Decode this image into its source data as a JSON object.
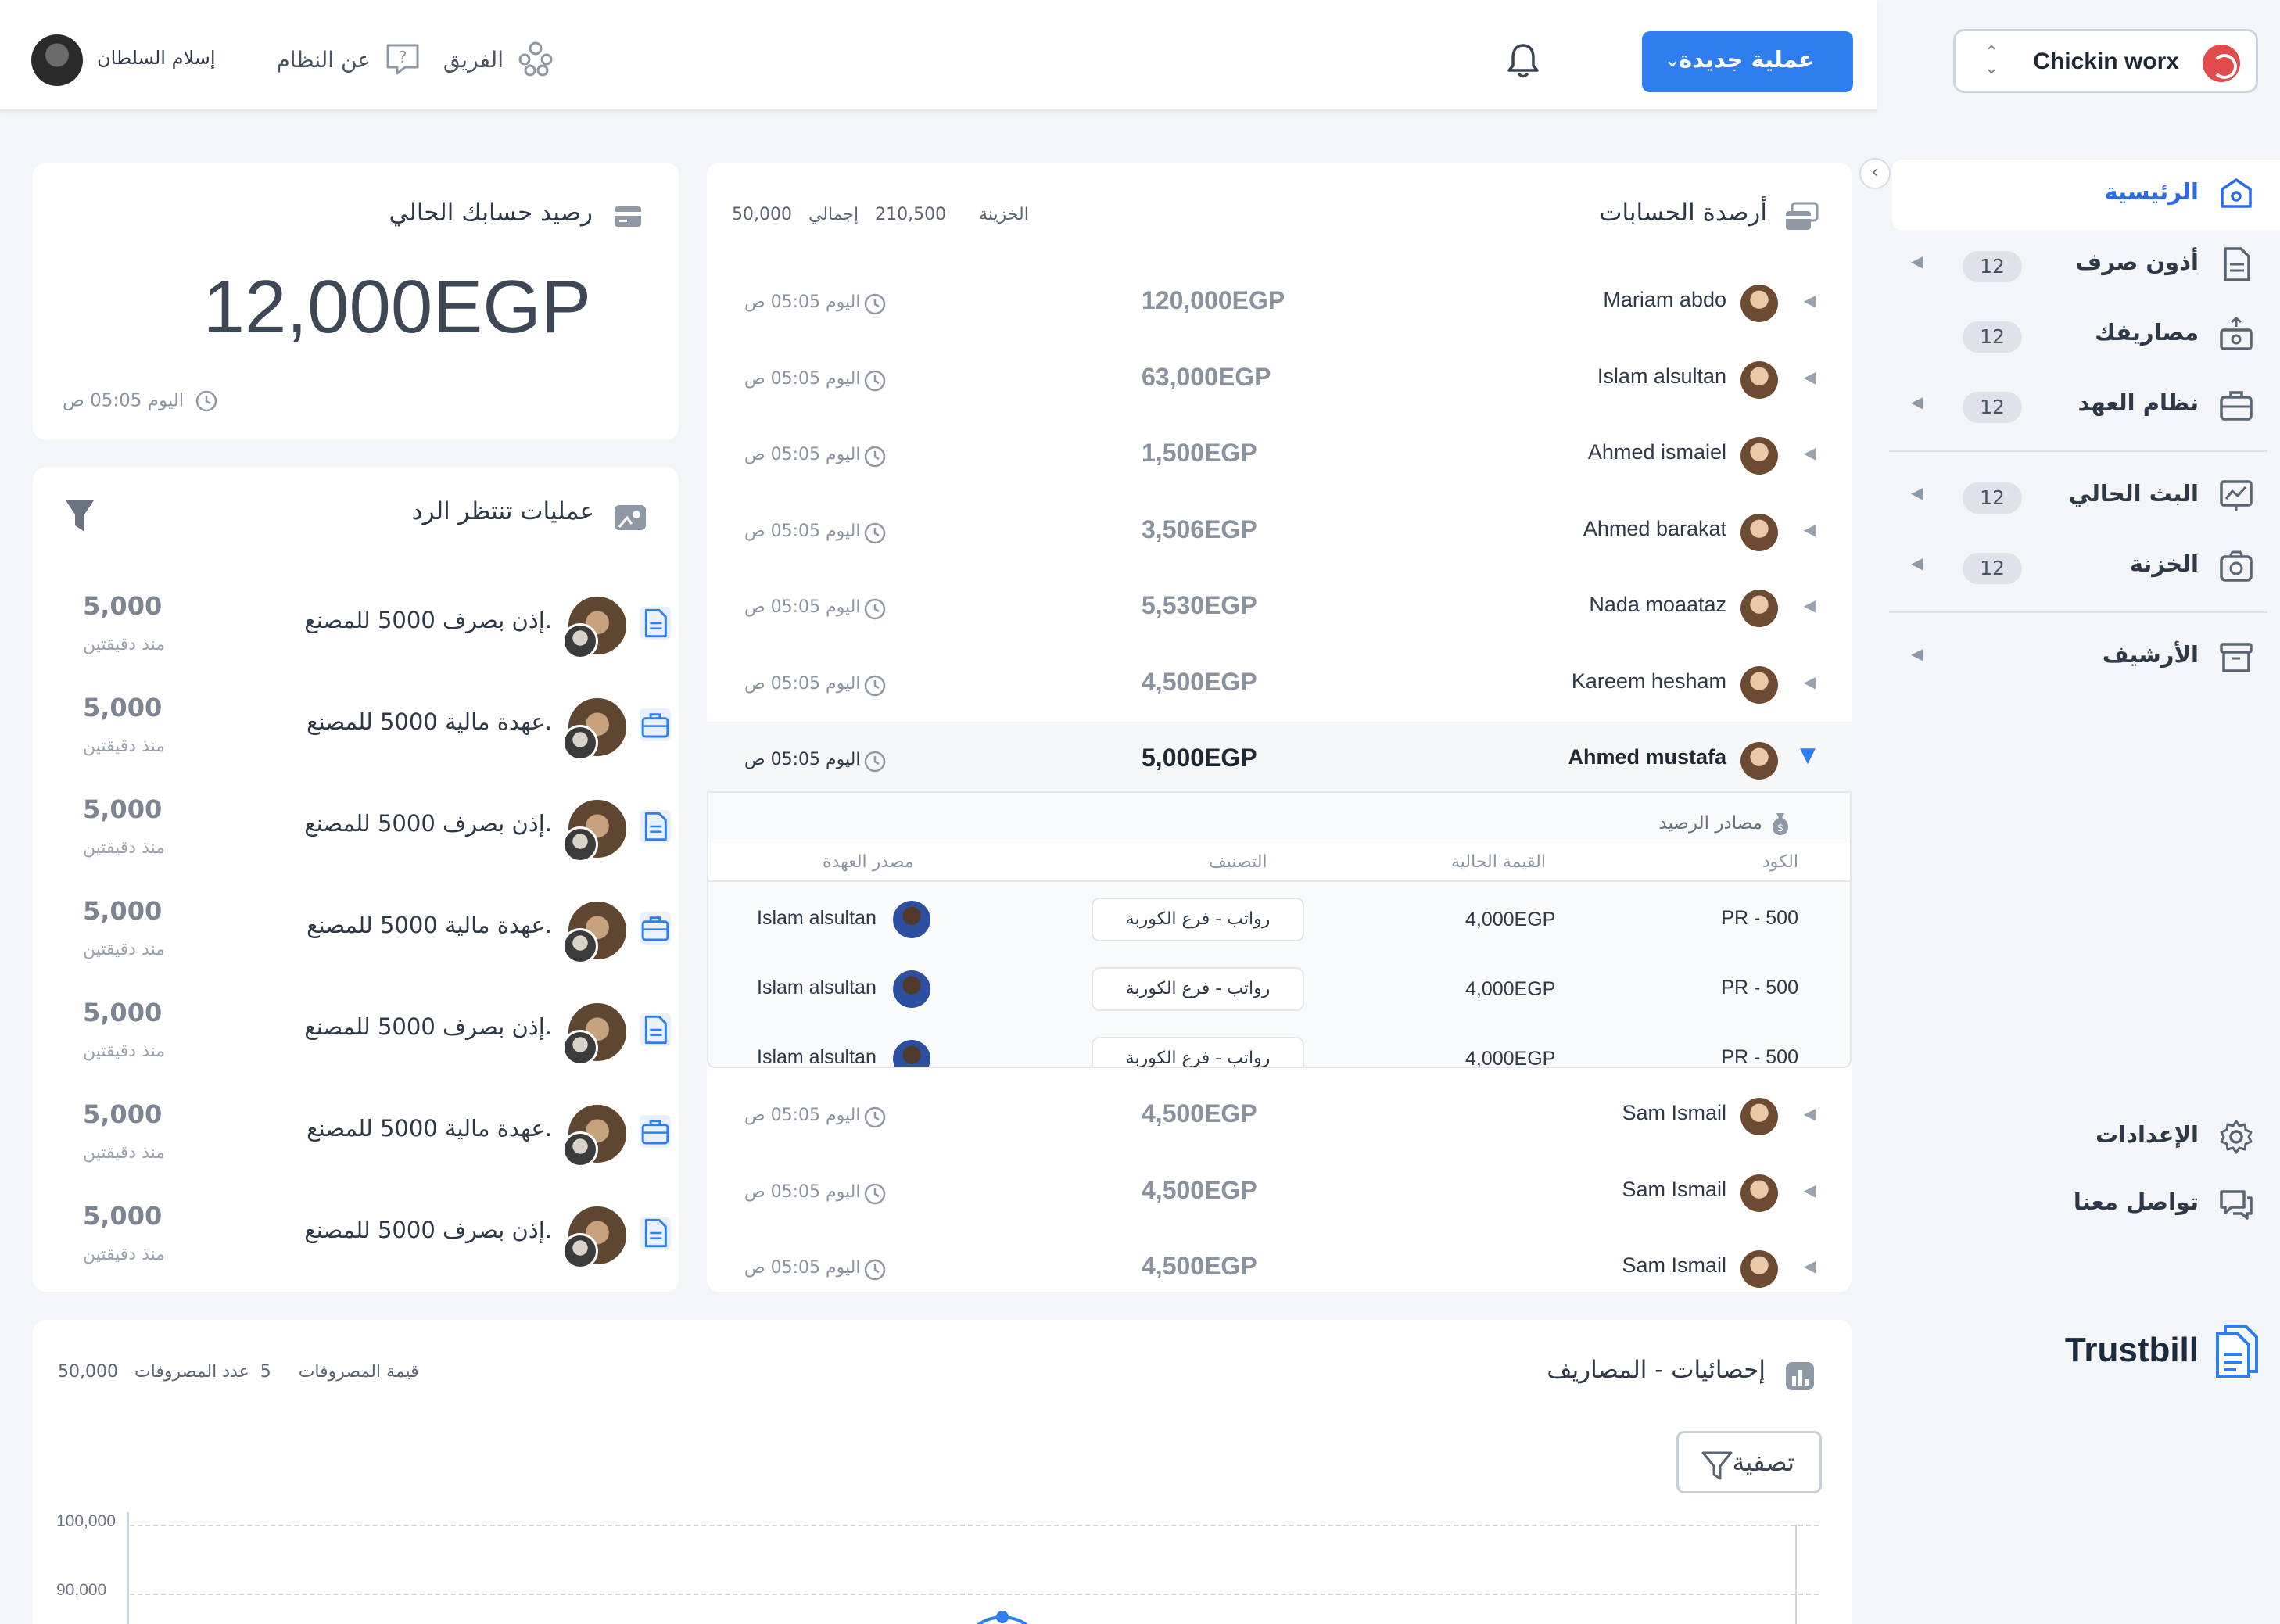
{
  "sidebar": {
    "company_name": "Chickin worx",
    "nav": [
      {
        "label": "الرئيسية",
        "icon": "home-icon",
        "active": true
      },
      {
        "label": "أذون صرف",
        "icon": "document-icon",
        "badge": "12",
        "caret": true
      },
      {
        "label": "مصاريفك",
        "icon": "money-out-icon",
        "badge": "12",
        "caret": false
      },
      {
        "label": "نظام العهد",
        "icon": "briefcase-icon",
        "badge": "12",
        "caret": true
      },
      {
        "label": "البث الحالي",
        "icon": "broadcast-chart-icon",
        "badge": "12",
        "caret": true
      },
      {
        "label": "الخزنة",
        "icon": "safe-icon",
        "badge": "12",
        "caret": true
      },
      {
        "label": "الأرشيف",
        "icon": "archive-icon",
        "caret": true
      }
    ],
    "bottom": [
      {
        "label": "الإعدادات",
        "icon": "gear-icon"
      },
      {
        "label": "تواصل معنا",
        "icon": "chat-icon"
      }
    ],
    "brand": "Trustbill"
  },
  "topbar": {
    "new_operation": "عملية جديدة",
    "team": "الفريق",
    "about": "عن النظام",
    "user_name": "إسلام السلطان"
  },
  "balance": {
    "title": "رصيد حسابك الحالي",
    "amount": "12,000EGP",
    "time": "اليوم 05:05 ص"
  },
  "pending": {
    "title": "عمليات تنتظر الرد",
    "items": [
      {
        "text": "إذن بصرف 5000 للمصنع.",
        "amount": "5,000",
        "time": "منذ دقيقتين",
        "type": "document"
      },
      {
        "text": "عهدة مالية 5000 للمصنع.",
        "amount": "5,000",
        "time": "منذ دقيقتين",
        "type": "briefcase"
      },
      {
        "text": "إذن بصرف 5000 للمصنع.",
        "amount": "5,000",
        "time": "منذ دقيقتين",
        "type": "document"
      },
      {
        "text": "عهدة مالية 5000 للمصنع.",
        "amount": "5,000",
        "time": "منذ دقيقتين",
        "type": "briefcase"
      },
      {
        "text": "إذن بصرف 5000 للمصنع.",
        "amount": "5,000",
        "time": "منذ دقيقتين",
        "type": "document"
      },
      {
        "text": "عهدة مالية 5000 للمصنع.",
        "amount": "5,000",
        "time": "منذ دقيقتين",
        "type": "briefcase"
      },
      {
        "text": "إذن بصرف 5000 للمصنع.",
        "amount": "5,000",
        "time": "منذ دقيقتين",
        "type": "document"
      }
    ]
  },
  "accounts": {
    "title": "أرصدة الحسابات",
    "total_label": "إجمالي",
    "total": "210,500",
    "treasury_label": "الخزينة",
    "treasury": "50,000",
    "rows": [
      {
        "name": "Mariam abdo",
        "amount": "120,000EGP",
        "time": "اليوم 05:05 ص"
      },
      {
        "name": "Islam alsultan",
        "amount": "63,000EGP",
        "time": "اليوم 05:05 ص"
      },
      {
        "name": "Ahmed ismaiel",
        "amount": "1,500EGP",
        "time": "اليوم 05:05 ص"
      },
      {
        "name": "Ahmed barakat",
        "amount": "3,506EGP",
        "time": "اليوم 05:05 ص"
      },
      {
        "name": "Nada moaataz",
        "amount": "5,530EGP",
        "time": "اليوم 05:05 ص"
      },
      {
        "name": "Kareem hesham",
        "amount": "4,500EGP",
        "time": "اليوم 05:05 ص"
      },
      {
        "name": "Ahmed mustafa",
        "amount": "5,000EGP",
        "time": "اليوم 05:05 ص",
        "open": true
      }
    ],
    "rows_after": [
      {
        "name": "Sam Ismail",
        "amount": "4,500EGP",
        "time": "اليوم 05:05 ص"
      },
      {
        "name": "Sam Ismail",
        "amount": "4,500EGP",
        "time": "اليوم 05:05 ص"
      },
      {
        "name": "Sam Ismail",
        "amount": "4,500EGP",
        "time": "اليوم 05:05 ص"
      }
    ],
    "sources": {
      "title": "مصادر الرصيد",
      "headers": {
        "code": "الكود",
        "value": "القيمة الحالية",
        "category": "التصنيف",
        "source": "مصدر العهدة"
      },
      "rows": [
        {
          "code": "PR - 500",
          "value": "4,000EGP",
          "category": "رواتب - فرع الكوربة",
          "source": "Islam alsultan"
        },
        {
          "code": "PR - 500",
          "value": "4,000EGP",
          "category": "رواتب - فرع الكوربة",
          "source": "Islam alsultan"
        },
        {
          "code": "PR - 500",
          "value": "4,000EGP",
          "category": "رواتب - فرع الكوربة",
          "source": "Islam alsultan"
        }
      ]
    }
  },
  "stats": {
    "title": "إحصائيات - المصاريف",
    "count_label": "عدد المصروفات",
    "count": "5",
    "value_label": "قيمة المصروفات",
    "value": "50,000",
    "filter": "تصفية",
    "y_ticks": [
      "100,000",
      "90,000"
    ]
  }
}
